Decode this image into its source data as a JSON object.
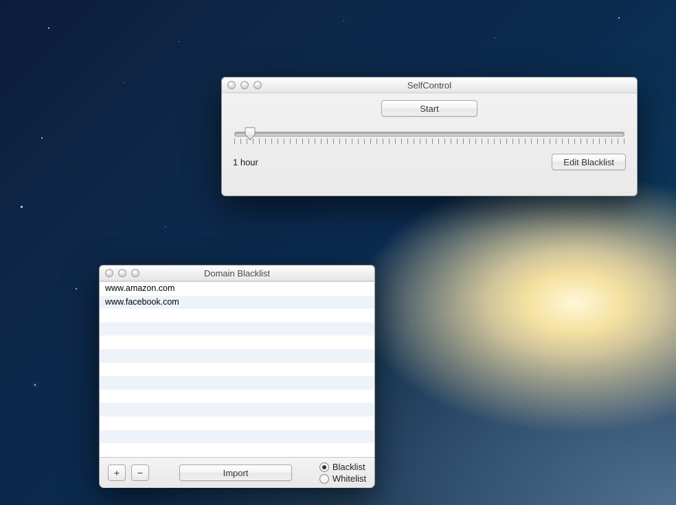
{
  "selfcontrol": {
    "title": "SelfControl",
    "start_label": "Start",
    "duration_label": "1 hour",
    "edit_blacklist_label": "Edit Blacklist",
    "slider_percent": 4
  },
  "blacklist": {
    "title": "Domain Blacklist",
    "domains": [
      "www.amazon.com",
      "www.facebook.com"
    ],
    "visible_rows": 13,
    "add_label": "+",
    "remove_label": "−",
    "import_label": "Import",
    "mode_options": {
      "blacklist": "Blacklist",
      "whitelist": "Whitelist"
    },
    "mode_selected": "blacklist"
  }
}
